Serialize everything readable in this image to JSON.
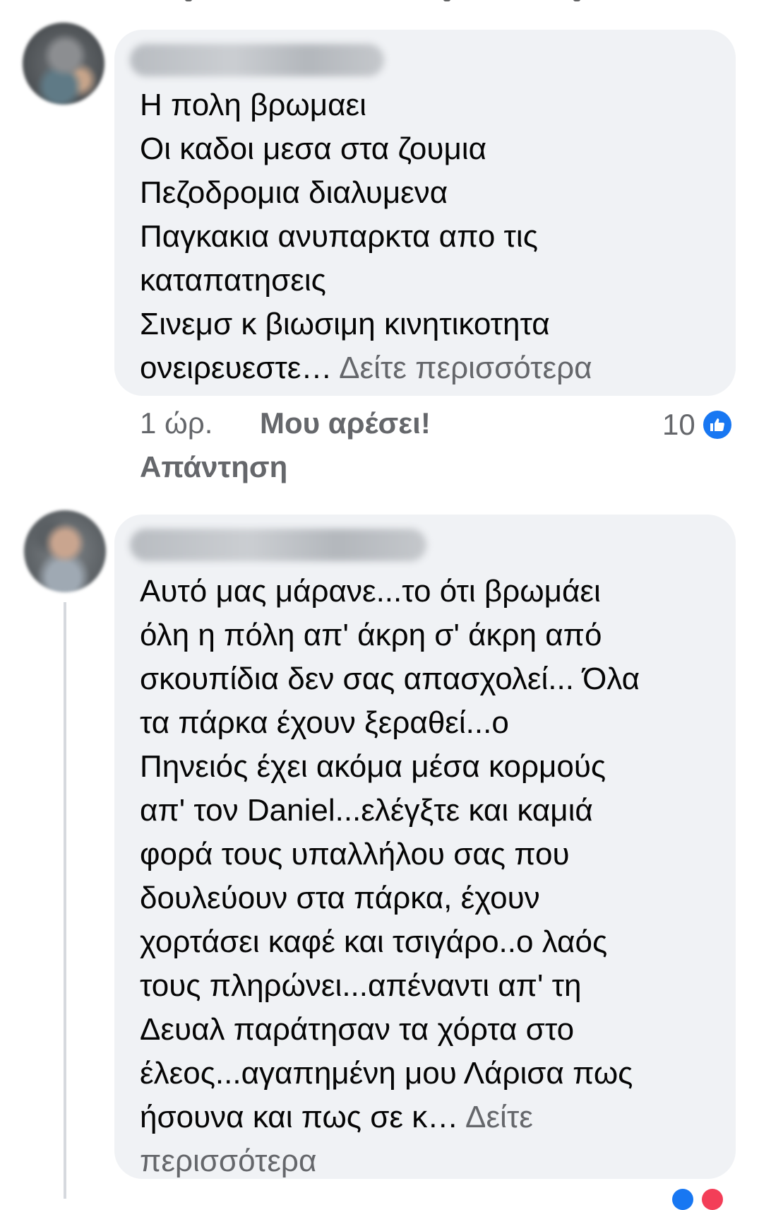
{
  "comments": [
    {
      "author_name": "",
      "lines": [
        "Η πολη βρωμαει",
        "Οι καδοι μεσα στα ζουμια",
        "Πεζοδρομια διαλυμενα",
        "Παγκακια ανυπαρκτα απο τις",
        "καταπατησεις",
        "Σινεμσ κ βιωσιμη κινητικοτητα",
        "ονειρευεστε…"
      ],
      "see_more": "Δείτε περισσότερα",
      "time": "1 ώρ.",
      "like_label": "Μου αρέσει!",
      "reply_label": "Απάντηση",
      "reaction_count": "10",
      "reaction_icon": "like-thumb-icon",
      "reaction_color": "#1877f2"
    },
    {
      "author_name": "",
      "lines": [
        "Αυτό μας μάρανε...το ότι βρωμάει",
        "όλη η πόλη απ' άκρη σ' άκρη  από",
        "σκουπίδια δεν σας απασχολεί... Όλα",
        "τα πάρκα  έχουν ξεραθεί...ο",
        "Πηνειός έχει ακόμα  μέσα κορμούς",
        "απ' τον Daniel...ελέγξτε και καμιά",
        "φορά τους υπαλλήλου σας που",
        "δουλεύουν στα πάρκα, έχουν",
        "χορτάσει καφέ και τσιγάρο..ο λαός",
        "τους πληρώνει...απέναντι απ' τη",
        "Δευαλ  παράτησαν τα χόρτα στο",
        "έλεος...αγαπημένη μου Λάρισα πως",
        "ήσουνα και πως σε κ… "
      ],
      "see_more_line1": "Δείτε",
      "see_more_line2": "περισσότερα"
    }
  ],
  "colors": {
    "bubble_bg": "#f0f2f5",
    "secondary_text": "#65676b",
    "primary_text": "#050505",
    "brand_blue": "#1877f2"
  }
}
